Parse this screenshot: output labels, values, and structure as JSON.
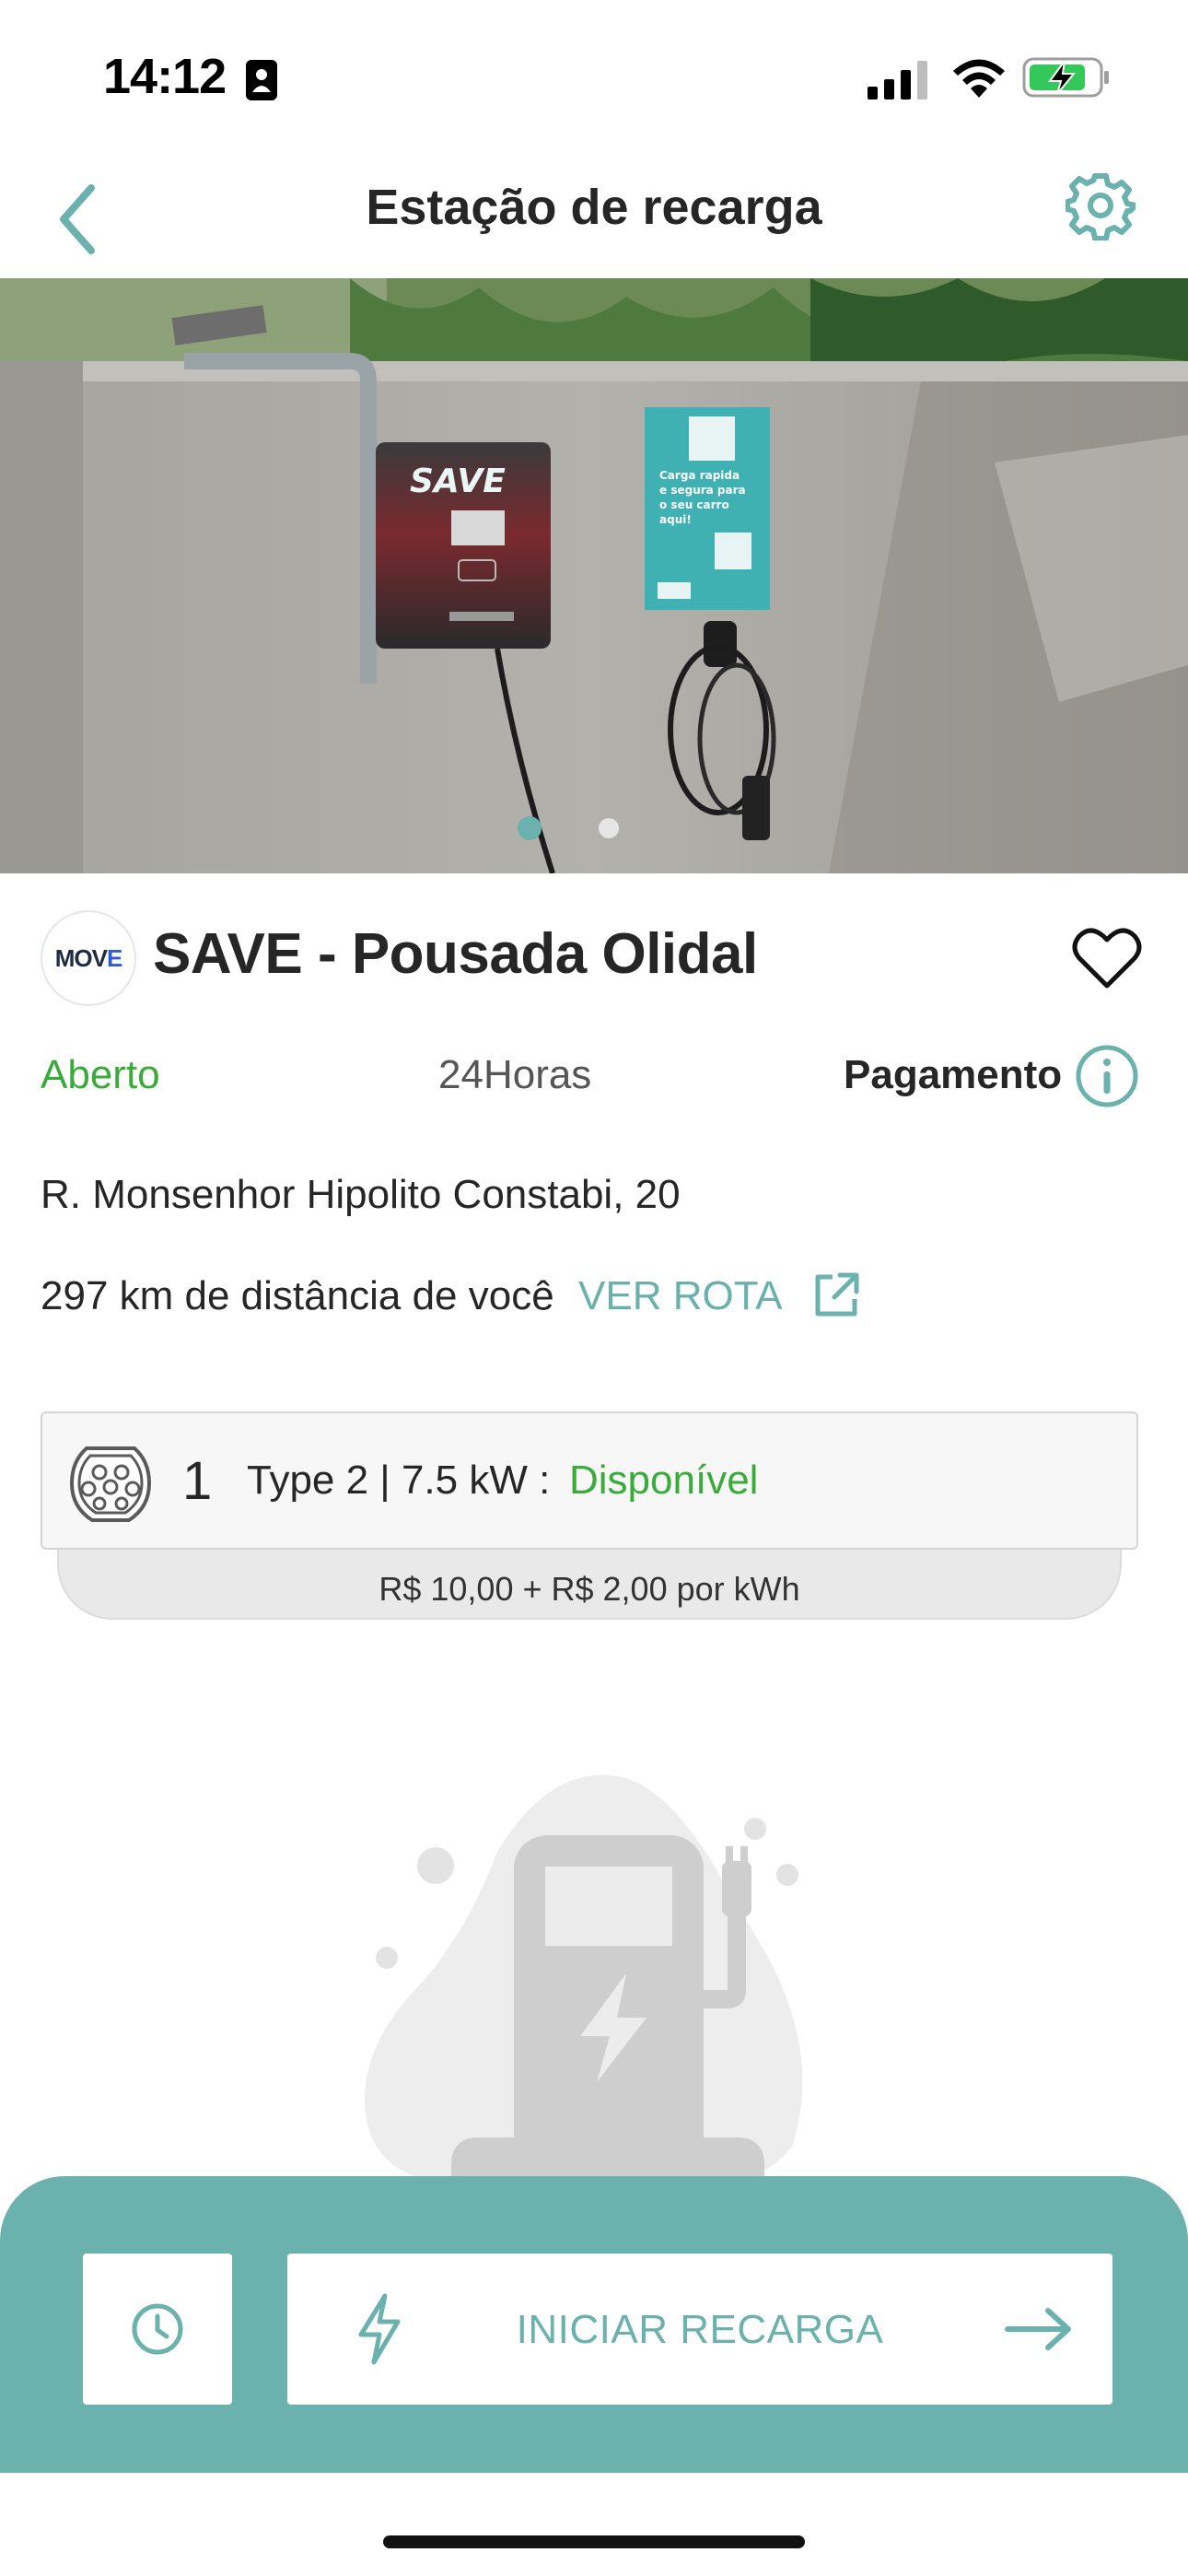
{
  "status_bar": {
    "time": "14:12"
  },
  "header": {
    "title": "Estação de recarga",
    "back_icon": "chevron-left-icon",
    "settings_icon": "gear-icon"
  },
  "station": {
    "logo_text_prefix": "MOV",
    "logo_text_suffix": "E",
    "name": "SAVE - Pousada Olidal",
    "favorite_icon": "heart-icon",
    "open_status": "Aberto",
    "hours": "24Horas",
    "payment_label": "Pagamento",
    "address": "R. Monsenhor Hipolito Constabi, 20",
    "distance": "297 km de distância de você",
    "route_link": "VER ROTA"
  },
  "photo": {
    "charger_brand": "SAVE",
    "sign_text": "Carga rapida e segura para o seu carro aqui!",
    "carousel_count": 2,
    "carousel_active": 0
  },
  "connector": {
    "count": "1",
    "description": "Type 2 | 7.5 kW :",
    "status": "Disponível",
    "price": "R$ 10,00 + R$ 2,00 por kWh"
  },
  "actions": {
    "start_label": "INICIAR RECARGA",
    "schedule_icon": "clock-icon",
    "bolt_icon": "lightning-icon",
    "arrow_icon": "arrow-right-icon"
  },
  "colors": {
    "accent": "#6bb1ad",
    "available_green": "#3aab3a",
    "text": "#262626"
  }
}
